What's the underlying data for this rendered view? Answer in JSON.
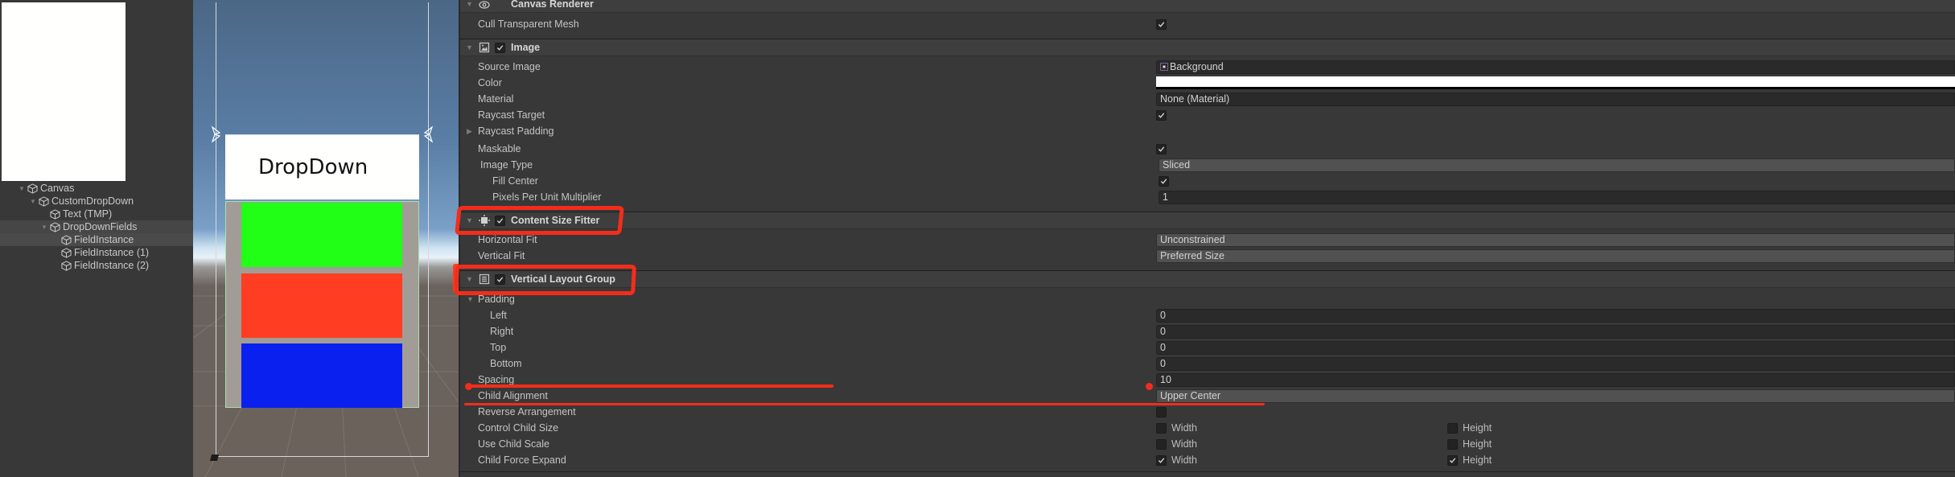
{
  "hierarchy": {
    "items": [
      {
        "label": "Canvas",
        "depth": 1,
        "expanded": true
      },
      {
        "label": "CustomDropDown",
        "depth": 2,
        "expanded": true
      },
      {
        "label": "Text (TMP)",
        "depth": 3
      },
      {
        "label": "DropDownFields",
        "depth": 3,
        "expanded": true,
        "state": "selected-parent"
      },
      {
        "label": "FieldInstance",
        "depth": 4,
        "state": "selected"
      },
      {
        "label": "FieldInstance (1)",
        "depth": 4
      },
      {
        "label": "FieldInstance (2)",
        "depth": 4
      }
    ]
  },
  "scene": {
    "dropdown_text": "DropDown",
    "fields": [
      {
        "name": "FieldInstance",
        "color": "#22ff16"
      },
      {
        "name": "FieldInstance (1)",
        "color": "#ff3d22"
      },
      {
        "name": "FieldInstance (2)",
        "color": "#0a20ee"
      }
    ]
  },
  "inspector": {
    "canvas_renderer": {
      "title": "Canvas Renderer",
      "cull_transparent_mesh": {
        "label": "Cull Transparent Mesh",
        "checked": true
      }
    },
    "image": {
      "title": "Image",
      "enabled": true,
      "source_image": {
        "label": "Source Image",
        "value": "Background"
      },
      "color": {
        "label": "Color",
        "value": "#ffffff"
      },
      "material": {
        "label": "Material",
        "value": "None (Material)"
      },
      "raycast_target": {
        "label": "Raycast Target",
        "checked": true
      },
      "raycast_padding": {
        "label": "Raycast Padding"
      },
      "maskable": {
        "label": "Maskable",
        "checked": true
      },
      "image_type": {
        "label": "Image Type",
        "value": "Sliced"
      },
      "fill_center": {
        "label": "Fill Center",
        "checked": true
      },
      "pixels_per_unit": {
        "label": "Pixels Per Unit Multiplier",
        "value": "1"
      }
    },
    "content_size_fitter": {
      "title": "Content Size Fitter",
      "enabled": true,
      "horizontal_fit": {
        "label": "Horizontal Fit",
        "value": "Unconstrained"
      },
      "vertical_fit": {
        "label": "Vertical Fit",
        "value": "Preferred Size"
      }
    },
    "vertical_layout_group": {
      "title": "Vertical Layout Group",
      "enabled": true,
      "padding": {
        "label": "Padding"
      },
      "left": {
        "label": "Left",
        "value": "0"
      },
      "right": {
        "label": "Right",
        "value": "0"
      },
      "top": {
        "label": "Top",
        "value": "0"
      },
      "bottom": {
        "label": "Bottom",
        "value": "0"
      },
      "spacing": {
        "label": "Spacing",
        "value": "10"
      },
      "child_alignment": {
        "label": "Child Alignment",
        "value": "Upper Center"
      },
      "reverse_arrangement": {
        "label": "Reverse Arrangement",
        "checked": false
      },
      "control_child_size": {
        "label": "Control Child Size",
        "width_label": "Width",
        "height_label": "Height",
        "width": false,
        "height": false
      },
      "use_child_scale": {
        "label": "Use Child Scale",
        "width_label": "Width",
        "height_label": "Height",
        "width": false,
        "height": false
      },
      "child_force_expand": {
        "label": "Child Force Expand",
        "width_label": "Width",
        "height_label": "Height",
        "width": true,
        "height": true
      }
    }
  },
  "annotations": {
    "highlight_color": "#f32d1b"
  }
}
